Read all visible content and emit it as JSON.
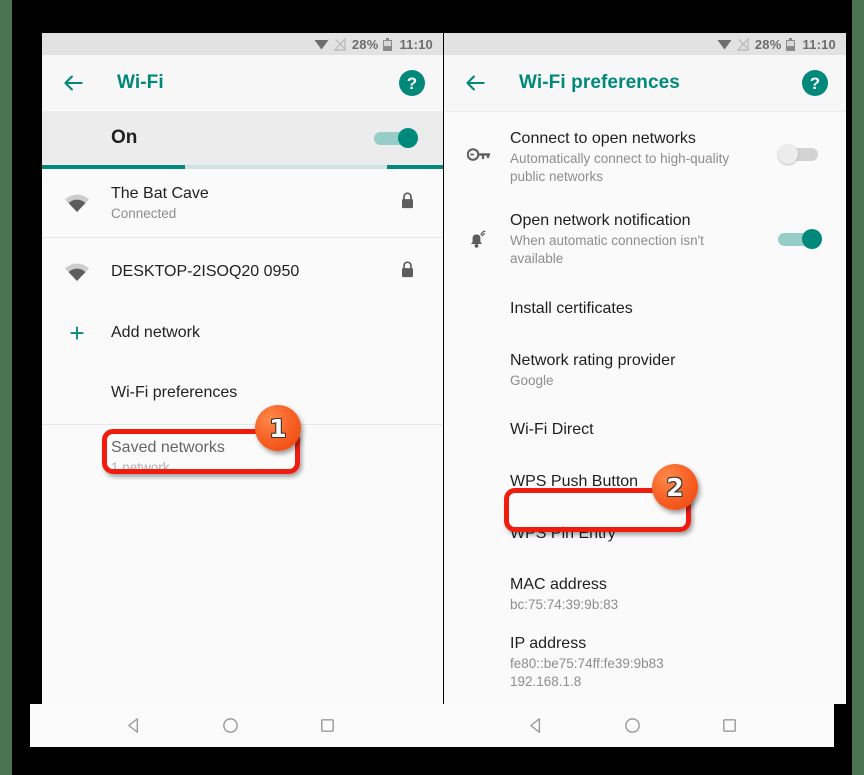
{
  "statusbar": {
    "battery_percent": "28%",
    "time": "11:10",
    "icons": [
      "wifi-icon",
      "signal-muted-icon",
      "battery-icon"
    ]
  },
  "left_phone": {
    "appbar": {
      "back_icon": "back-arrow-icon",
      "title": "Wi-Fi",
      "help_icon": "help-icon",
      "help_label": "?"
    },
    "toggle_row": {
      "label": "On",
      "switch_state": "on"
    },
    "items": [
      {
        "title": "The Bat Cave",
        "sub": "Connected",
        "lead_icon": "wifi-signal-icon",
        "trail_icon": "lock-icon"
      },
      {
        "title": "DESKTOP-2ISOQ20 0950",
        "sub": "",
        "lead_icon": "wifi-signal-icon",
        "trail_icon": "lock-icon"
      },
      {
        "title": "Add network",
        "sub": "",
        "lead_icon": "plus-icon",
        "trail_icon": ""
      },
      {
        "title": "Wi-Fi preferences",
        "sub": "",
        "lead_icon": "",
        "trail_icon": ""
      },
      {
        "title": "Saved networks",
        "sub": "1 network",
        "lead_icon": "",
        "trail_icon": ""
      }
    ]
  },
  "right_phone": {
    "appbar": {
      "back_icon": "back-arrow-icon",
      "title": "Wi-Fi preferences",
      "help_icon": "help-icon",
      "help_label": "?"
    },
    "items": [
      {
        "title": "Connect to open networks",
        "sub": "Automatically connect to high-quality public networks",
        "lead_icon": "key-icon",
        "switch_state": "off"
      },
      {
        "title": "Open network notification",
        "sub": "When automatic connection isn't available",
        "lead_icon": "bell-wifi-icon",
        "switch_state": "on"
      },
      {
        "title": "Install certificates",
        "sub": "",
        "lead_icon": "",
        "switch_state": ""
      },
      {
        "title": "Network rating provider",
        "sub": "Google",
        "lead_icon": "",
        "switch_state": ""
      },
      {
        "title": "Wi-Fi Direct",
        "sub": "",
        "lead_icon": "",
        "switch_state": ""
      },
      {
        "title": "WPS Push Button",
        "sub": "",
        "lead_icon": "",
        "switch_state": ""
      },
      {
        "title": "WPS Pin Entry",
        "sub": "",
        "lead_icon": "",
        "switch_state": ""
      },
      {
        "title": "MAC address",
        "sub": "bc:75:74:39:9b:83",
        "lead_icon": "",
        "switch_state": ""
      },
      {
        "title": "IP address",
        "sub": "fe80::be75:74ff:fe39:9b83\n192.168.1.8",
        "lead_icon": "",
        "switch_state": ""
      }
    ]
  },
  "navbar": {
    "back_icon": "nav-back-triangle-icon",
    "home_icon": "nav-home-circle-icon",
    "recents_icon": "nav-recents-square-icon"
  },
  "annotations": [
    {
      "number": "1",
      "target": "Wi-Fi preferences"
    },
    {
      "number": "2",
      "target": "WPS Push Button"
    }
  ],
  "colors": {
    "accent_teal": "#00897b",
    "annotation_red": "#f01d0e",
    "badge_orange": "#f8652a"
  }
}
